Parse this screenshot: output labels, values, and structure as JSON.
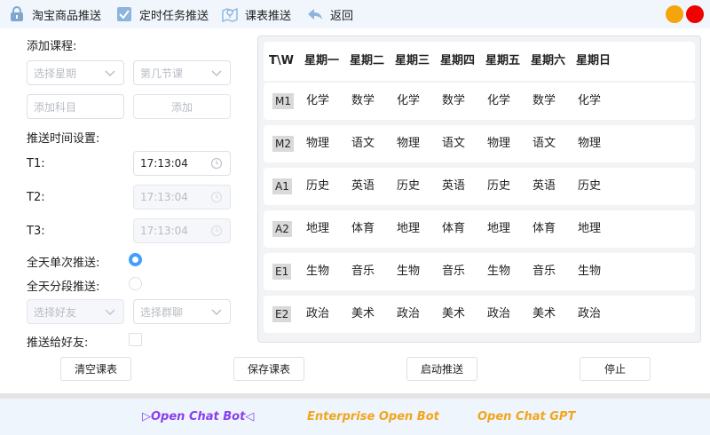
{
  "colors": {
    "accent": "#409eff",
    "window_min": "#f5a40a",
    "window_close": "#f00000",
    "footer_purple": "#8a3ff0",
    "footer_orange": "#f2a51c"
  },
  "toolbar": {
    "items": [
      {
        "label": "淘宝商品推送",
        "icon": "lock-icon"
      },
      {
        "label": "定时任务推送",
        "icon": "checkbox-icon"
      },
      {
        "label": "课表推送",
        "icon": "map-pin-icon"
      },
      {
        "label": "返回",
        "icon": "back-arrow-icon"
      }
    ]
  },
  "form": {
    "add_course_label": "添加课程:",
    "weekday_placeholder": "选择星期",
    "period_placeholder": "第几节课",
    "subject_placeholder": "添加科目",
    "add_button": "添加",
    "time_settings_label": "推送时间设置:",
    "t1_label": "T1:",
    "t1_value": "17:13:04",
    "t2_label": "T2:",
    "t2_value": "17:13:04",
    "t3_label": "T3:",
    "t3_value": "17:13:04",
    "single_push_label": "全天单次推送:",
    "segment_push_label": "全天分段推送:",
    "friend_placeholder": "选择好友",
    "group_placeholder": "选择群聊",
    "push_to_friend_label": "推送给好友:",
    "single_push_selected": true,
    "segment_push_selected": false,
    "push_to_friend_checked": false
  },
  "timetable": {
    "corner": "T\\W",
    "days": [
      "星期一",
      "星期二",
      "星期三",
      "星期四",
      "星期五",
      "星期六",
      "星期日"
    ],
    "rows": [
      {
        "label": "M1",
        "cells": [
          "化学",
          "数学",
          "化学",
          "数学",
          "化学",
          "数学",
          "化学"
        ]
      },
      {
        "label": "M2",
        "cells": [
          "物理",
          "语文",
          "物理",
          "语文",
          "物理",
          "语文",
          "物理"
        ]
      },
      {
        "label": "A1",
        "cells": [
          "历史",
          "英语",
          "历史",
          "英语",
          "历史",
          "英语",
          "历史"
        ]
      },
      {
        "label": "A2",
        "cells": [
          "地理",
          "体育",
          "地理",
          "体育",
          "地理",
          "体育",
          "地理"
        ]
      },
      {
        "label": "E1",
        "cells": [
          "生物",
          "音乐",
          "生物",
          "音乐",
          "生物",
          "音乐",
          "生物"
        ]
      },
      {
        "label": "E2",
        "cells": [
          "政治",
          "美术",
          "政治",
          "美术",
          "政治",
          "美术",
          "政治"
        ]
      }
    ]
  },
  "actions": {
    "clear": "清空课表",
    "save": "保存课表",
    "start": "启动推送",
    "stop": "停止"
  },
  "footer": {
    "links": [
      "▷Open Chat Bot◁",
      "Enterprise Open Bot",
      "Open Chat GPT"
    ]
  }
}
